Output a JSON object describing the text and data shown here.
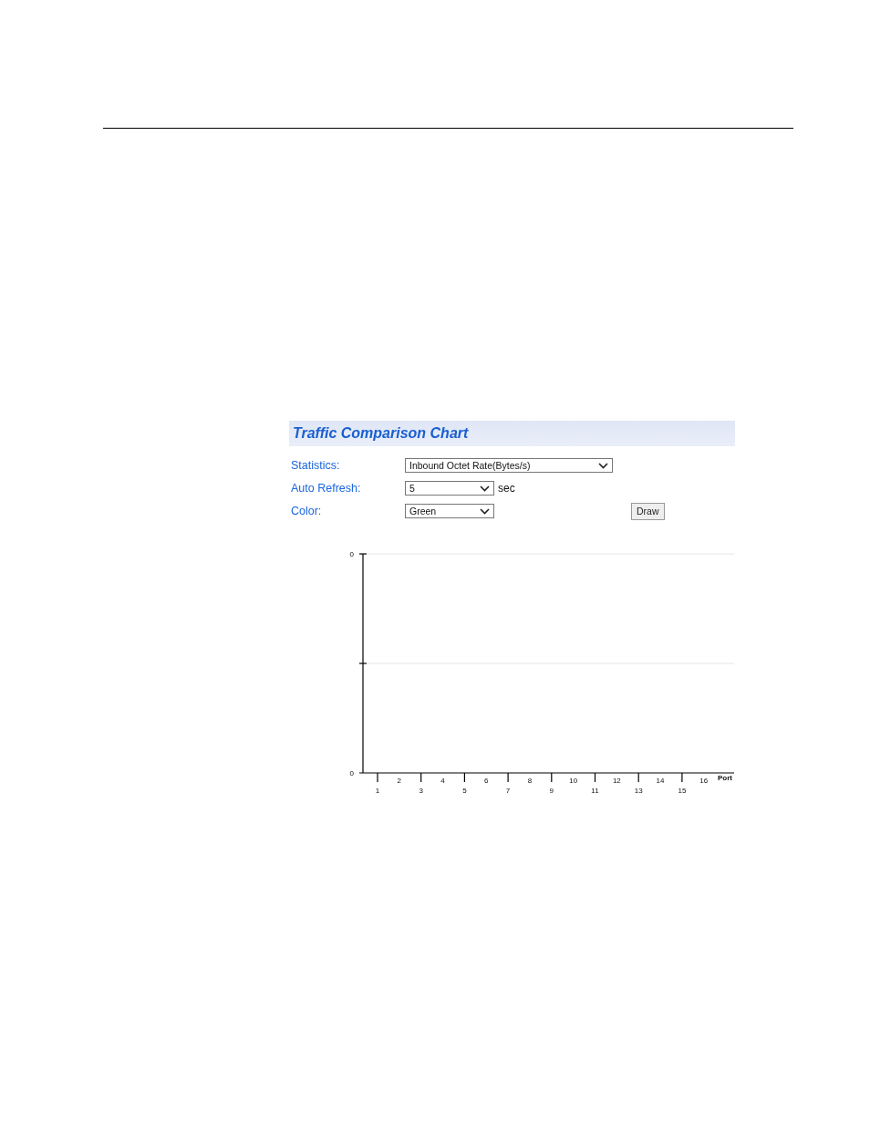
{
  "panel": {
    "title": "Traffic Comparison Chart"
  },
  "form": [
    {
      "label": "Statistics:",
      "value": "Inbound Octet Rate(Bytes/s)"
    },
    {
      "label": "Auto Refresh:",
      "value": "5",
      "unit": "sec"
    },
    {
      "label": "Color:",
      "value": "Green"
    }
  ],
  "draw_button": "Draw",
  "chart": {
    "y_labels": [
      "0",
      "0"
    ],
    "x_labels": [
      "1",
      "2",
      "3",
      "4",
      "5",
      "6",
      "7",
      "8",
      "9",
      "10",
      "11",
      "12",
      "13",
      "14",
      "15",
      "16"
    ],
    "x_title": "Port"
  }
}
